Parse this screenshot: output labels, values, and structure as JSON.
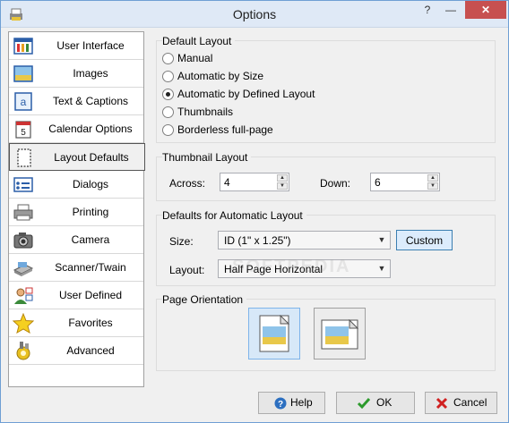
{
  "window": {
    "title": "Options",
    "help_glyph": "?",
    "minimize_glyph": "—",
    "close_glyph": "✕"
  },
  "sidebar": {
    "items": [
      {
        "label": "User Interface",
        "icon": "user-interface-icon",
        "active": false
      },
      {
        "label": "Images",
        "icon": "images-icon",
        "active": false
      },
      {
        "label": "Text & Captions",
        "icon": "text-captions-icon",
        "active": false
      },
      {
        "label": "Calendar Options",
        "icon": "calendar-icon",
        "active": false
      },
      {
        "label": "Layout Defaults",
        "icon": "layout-icon",
        "active": true
      },
      {
        "label": "Dialogs",
        "icon": "dialogs-icon",
        "active": false
      },
      {
        "label": "Printing",
        "icon": "printer-icon",
        "active": false
      },
      {
        "label": "Camera",
        "icon": "camera-icon",
        "active": false
      },
      {
        "label": "Scanner/Twain",
        "icon": "scanner-icon",
        "active": false
      },
      {
        "label": "User Defined",
        "icon": "user-defined-icon",
        "active": false
      },
      {
        "label": "Favorites",
        "icon": "star-icon",
        "active": false
      },
      {
        "label": "Advanced",
        "icon": "advanced-icon",
        "active": false
      }
    ],
    "calendar_icon_text": "5",
    "text_icon_text": "a"
  },
  "default_layout": {
    "title": "Default Layout",
    "options": [
      "Manual",
      "Automatic by Size",
      "Automatic by Defined Layout",
      "Thumbnails",
      "Borderless full-page"
    ],
    "selected": "Automatic by Defined Layout"
  },
  "thumbnail_layout": {
    "title": "Thumbnail Layout",
    "across_label": "Across:",
    "across_value": "4",
    "down_label": "Down:",
    "down_value": "6"
  },
  "auto_layout": {
    "title": "Defaults for Automatic Layout",
    "size_label": "Size:",
    "size_value": "ID (1\" x 1.25\")",
    "custom_button": "Custom",
    "layout_label": "Layout:",
    "layout_value": "Half Page Horizontal"
  },
  "page_orientation": {
    "title": "Page Orientation",
    "selected": "portrait"
  },
  "footer": {
    "help": "Help",
    "ok": "OK",
    "cancel": "Cancel"
  },
  "watermark": "SOFTPEDIA",
  "colors": {
    "close_button": "#c75050",
    "selected_highlight": "#d7e8f8",
    "ok_check": "#2c9a2c",
    "cancel_x": "#d02020",
    "help_icon": "#2c6fc0"
  }
}
